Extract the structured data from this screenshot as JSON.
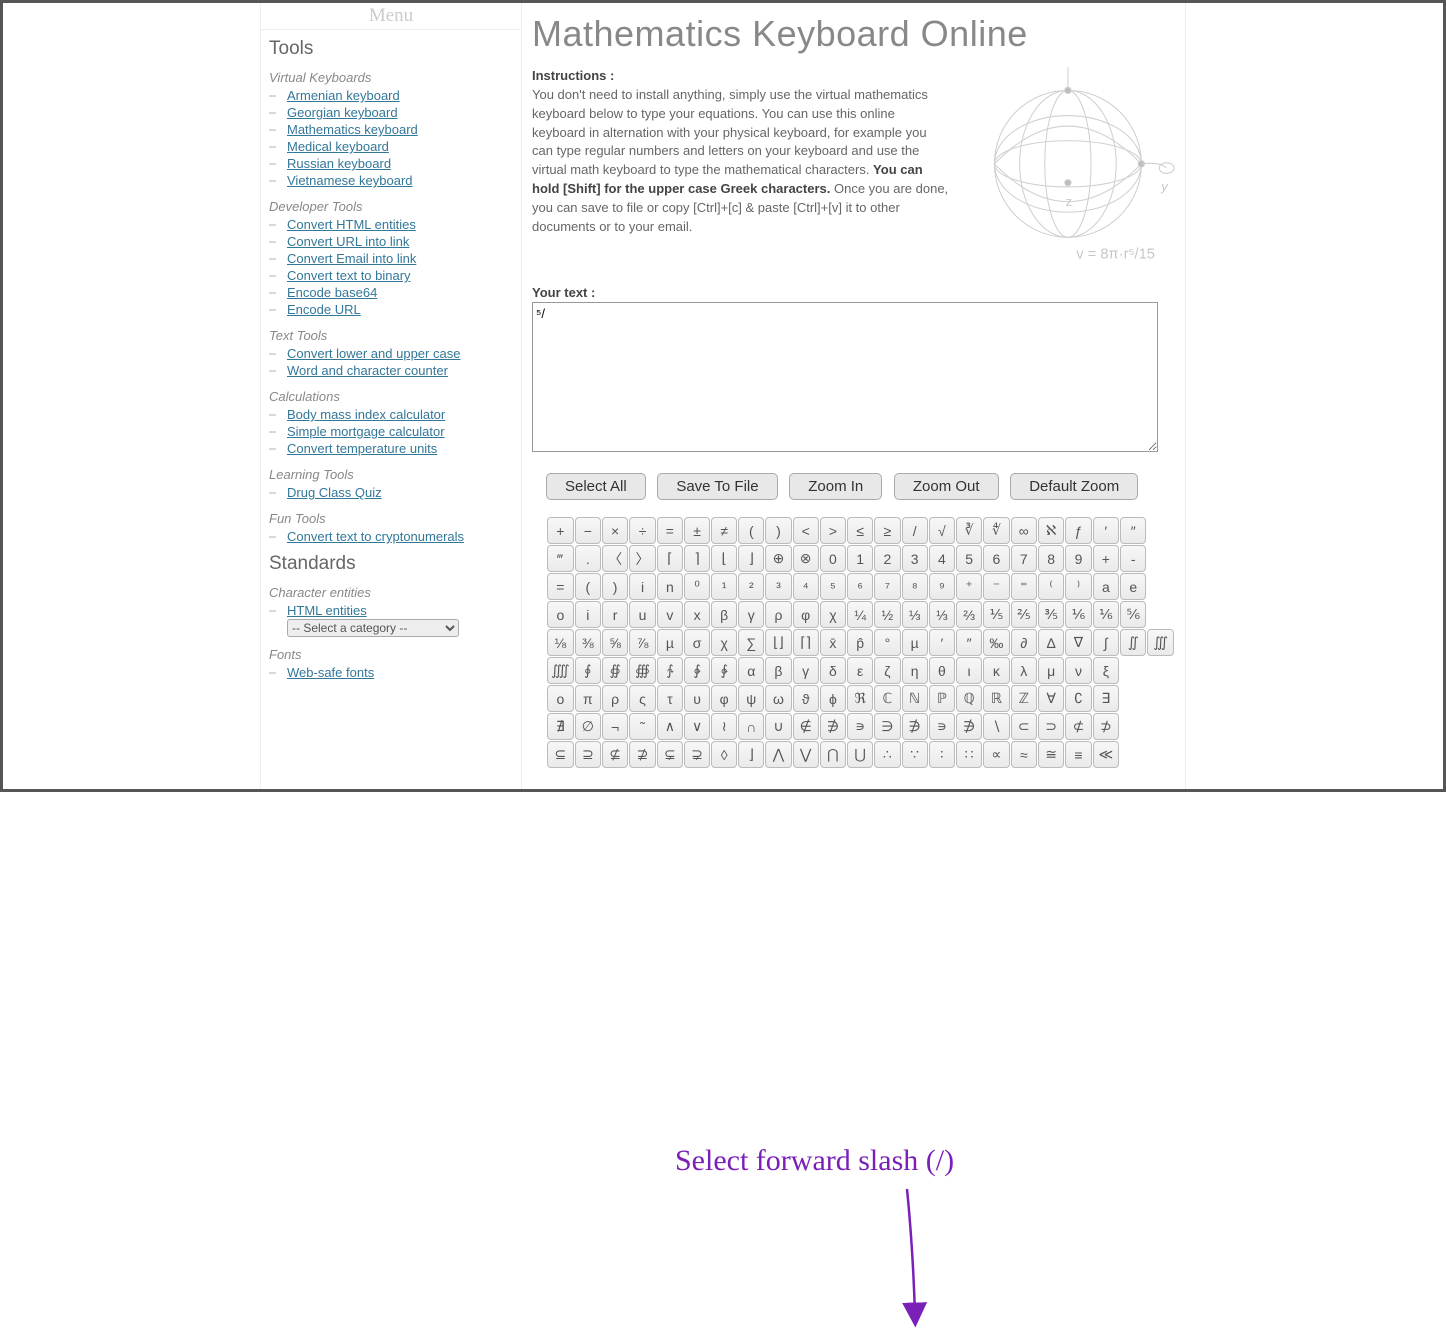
{
  "menu_script": "Menu",
  "sidebar": {
    "tools_heading": "Tools",
    "standards_heading": "Standards",
    "sections": [
      {
        "heading": "Virtual Keyboards",
        "items": [
          "Armenian keyboard",
          "Georgian keyboard",
          "Mathematics keyboard",
          "Medical keyboard",
          "Russian keyboard",
          "Vietnamese keyboard"
        ]
      },
      {
        "heading": "Developer Tools",
        "items": [
          "Convert HTML entities",
          "Convert URL into link",
          "Convert Email into link",
          "Convert text to binary",
          "Encode base64",
          "Encode URL"
        ]
      },
      {
        "heading": "Text Tools",
        "items": [
          "Convert lower and upper case",
          "Word and character counter"
        ]
      },
      {
        "heading": "Calculations",
        "items": [
          "Body mass index calculator",
          "Simple mortgage calculator",
          "Convert temperature units"
        ]
      },
      {
        "heading": "Learning Tools",
        "items": [
          "Drug Class Quiz"
        ]
      },
      {
        "heading": "Fun Tools",
        "items": [
          "Convert text to cryptonumerals"
        ]
      }
    ],
    "char_entities_heading": "Character entities",
    "char_entities_items": [
      "HTML entities"
    ],
    "category_select": "-- Select a category --",
    "fonts_heading": "Fonts",
    "fonts_items": [
      "Web-safe fonts"
    ]
  },
  "main": {
    "title": "Mathematics Keyboard Online",
    "instructions_label": "Instructions :",
    "instructions_body": "You don't need to install anything, simply use the virtual mathematics keyboard below to type your equations. You can use this online keyboard in alternation with your physical keyboard, for example you can type regular numbers and letters on your keyboard and use the virtual math keyboard to type the mathematical characters. ",
    "shift_note": "You can hold [Shift] for the upper case Greek characters.",
    "instructions_tail": " Once you are done, you can save to file or copy [Ctrl]+[c] & paste [Ctrl]+[v] it to other documents or to your email.",
    "yourtext_label": "Your text :",
    "textarea_value": "⁵/",
    "buttons": {
      "select_all": "Select All",
      "save": "Save To File",
      "zoom_in": "Zoom In",
      "zoom_out": "Zoom Out",
      "default_zoom": "Default Zoom"
    }
  },
  "keyboard_rows": [
    [
      "+",
      "−",
      "×",
      "÷",
      "=",
      "±",
      "≠",
      "(",
      ")",
      "<",
      ">",
      "≤",
      "≥",
      "/",
      "√",
      "∛",
      "∜",
      "∞",
      "ℵ",
      "ƒ",
      "′",
      "″"
    ],
    [
      "‴",
      ".",
      "〈",
      "〉",
      "⌈",
      "⌉",
      "⌊",
      "⌋",
      "⊕",
      "⊗",
      "0",
      "1",
      "2",
      "3",
      "4",
      "5",
      "6",
      "7",
      "8",
      "9",
      "+",
      "-"
    ],
    [
      "=",
      "(",
      ")",
      "i",
      "n",
      "⁰",
      "¹",
      "²",
      "³",
      "⁴",
      "⁵",
      "⁶",
      "⁷",
      "⁸",
      "⁹",
      "⁺",
      "⁻",
      "⁼",
      "⁽",
      "⁾",
      "a",
      "e"
    ],
    [
      "o",
      "i",
      "r",
      "u",
      "v",
      "x",
      "β",
      "γ",
      "ρ",
      "φ",
      "χ",
      "¼",
      "½",
      "⅓",
      "⅓",
      "⅔",
      "⅕",
      "⅖",
      "⅗",
      "⅙",
      "⅙",
      "⅚"
    ],
    [
      "⅛",
      "⅜",
      "⅝",
      "⅞",
      "µ",
      "σ",
      "χ",
      "∑",
      "⌊⌋",
      "⌈⌉",
      "x̄",
      "p̂",
      "°",
      "µ",
      "′",
      "″",
      "‰",
      "∂",
      "∆",
      "∇",
      "∫",
      "∬",
      "∭"
    ],
    [
      "⨌",
      "∮",
      "∯",
      "∰",
      "∱",
      "∲",
      "∳",
      "α",
      "β",
      "γ",
      "δ",
      "ε",
      "ζ",
      "η",
      "θ",
      "ι",
      "κ",
      "λ",
      "μ",
      "ν",
      "ξ"
    ],
    [
      "ο",
      "π",
      "ρ",
      "ς",
      "τ",
      "υ",
      "φ",
      "ψ",
      "ω",
      "ϑ",
      "ϕ",
      "ℜ",
      "ℂ",
      "ℕ",
      "ℙ",
      "ℚ",
      "ℝ",
      "ℤ",
      "∀",
      "∁",
      "∃"
    ],
    [
      "∄",
      "∅",
      "¬",
      "˜",
      "∧",
      "∨",
      "≀",
      "∩",
      "∪",
      "∉",
      "∌",
      "∍",
      "∋",
      "∌",
      "∍",
      "∌",
      "∖",
      "⊂",
      "⊃",
      "⊄",
      "⊅"
    ],
    [
      "⊆",
      "⊇",
      "⊈",
      "⊉",
      "⊊",
      "⊋",
      "◊",
      "⌋",
      "⋀",
      "⋁",
      "⋂",
      "⋃",
      "∴",
      "∵",
      "∶",
      "∷",
      "∝",
      "≈",
      "≅",
      "≡",
      "≪"
    ]
  ],
  "annotation": "Select forward slash (/)"
}
